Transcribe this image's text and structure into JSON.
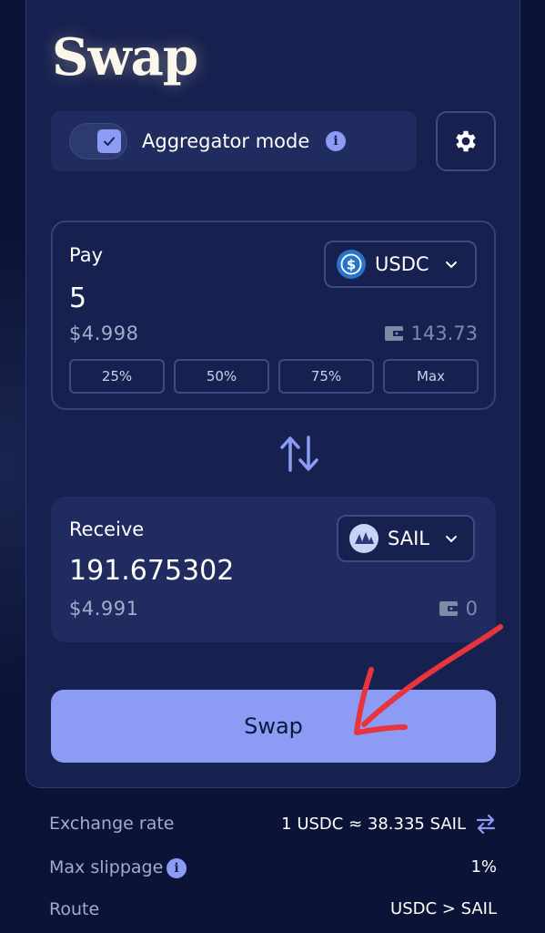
{
  "page_title": "Swap",
  "aggregator": {
    "label": "Aggregator mode",
    "checked": true
  },
  "pay": {
    "label": "Pay",
    "amount": "5",
    "usd_value": "$4.998",
    "balance": "143.73",
    "token": "USDC",
    "percent_buttons": [
      "25%",
      "50%",
      "75%",
      "Max"
    ]
  },
  "receive": {
    "label": "Receive",
    "amount": "191.675302",
    "usd_value": "$4.991",
    "balance": "0",
    "token": "SAIL"
  },
  "swap_button": "Swap",
  "details": {
    "exchange_rate": {
      "label": "Exchange rate",
      "value": "1 USDC ≈ 38.335 SAIL"
    },
    "max_slippage": {
      "label": "Max slippage",
      "value": "1%"
    },
    "route": {
      "label": "Route",
      "value": "USDC > SAIL"
    }
  },
  "colors": {
    "accent": "#8c9cf5",
    "card_bg": "#17214f",
    "page_bg": "#0b1336",
    "annotation_arrow": "#e8343c"
  }
}
